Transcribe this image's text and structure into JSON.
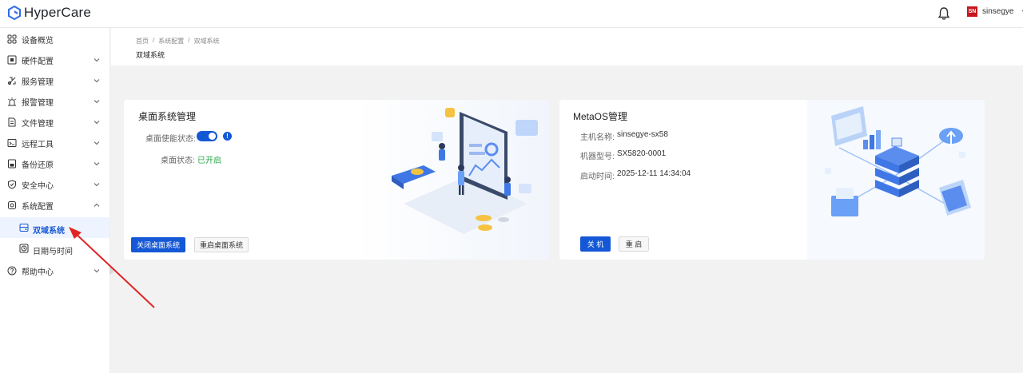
{
  "app": {
    "title": "HyperCare"
  },
  "user": {
    "avatar_text": "SN",
    "name": "sinsegye"
  },
  "sidebar": {
    "items": [
      {
        "label": "设备概览",
        "icon": "dashboard-icon",
        "has_chevron": false
      },
      {
        "label": "硬件配置",
        "icon": "hardware-icon",
        "has_chevron": true
      },
      {
        "label": "服务管理",
        "icon": "service-icon",
        "has_chevron": true
      },
      {
        "label": "报警管理",
        "icon": "alarm-icon",
        "has_chevron": true
      },
      {
        "label": "文件管理",
        "icon": "file-icon",
        "has_chevron": true
      },
      {
        "label": "远程工具",
        "icon": "remote-icon",
        "has_chevron": true
      },
      {
        "label": "备份还原",
        "icon": "backup-icon",
        "has_chevron": true
      },
      {
        "label": "安全中心",
        "icon": "shield-icon",
        "has_chevron": true
      },
      {
        "label": "系统配置",
        "icon": "settings-icon",
        "has_chevron": true,
        "expanded": true
      }
    ],
    "sub_items": [
      {
        "label": "双域系统",
        "icon": "dual-domain-icon",
        "active": true
      },
      {
        "label": "日期与时间",
        "icon": "clock-icon",
        "active": false
      }
    ],
    "help": {
      "label": "帮助中心",
      "icon": "help-icon"
    }
  },
  "breadcrumb": {
    "items": [
      "首页",
      "系统配置",
      "双域系统"
    ],
    "separator": "/"
  },
  "page_title": "双域系统",
  "desktop_card": {
    "title": "桌面系统管理",
    "enable_label": "桌面使能状态:",
    "enable_value": "on",
    "status_label": "桌面状态:",
    "status_value": "已开启",
    "buttons": {
      "shutdown": "关闭桌面系统",
      "restart": "重启桌面系统"
    }
  },
  "metaos_card": {
    "title": "MetaOS管理",
    "rows": [
      {
        "label": "主机名称:",
        "value": "sinsegye-sx58"
      },
      {
        "label": "机器型号:",
        "value": "SX5820-0001"
      },
      {
        "label": "启动时间:",
        "value": "2025-12-11 14:34:04"
      }
    ],
    "buttons": {
      "shutdown": "关 机",
      "restart": "重 启"
    }
  },
  "colors": {
    "primary": "#1558d6",
    "success": "#2aa84a",
    "annotation_arrow": "#e02424",
    "background": "#f2f2f2"
  }
}
